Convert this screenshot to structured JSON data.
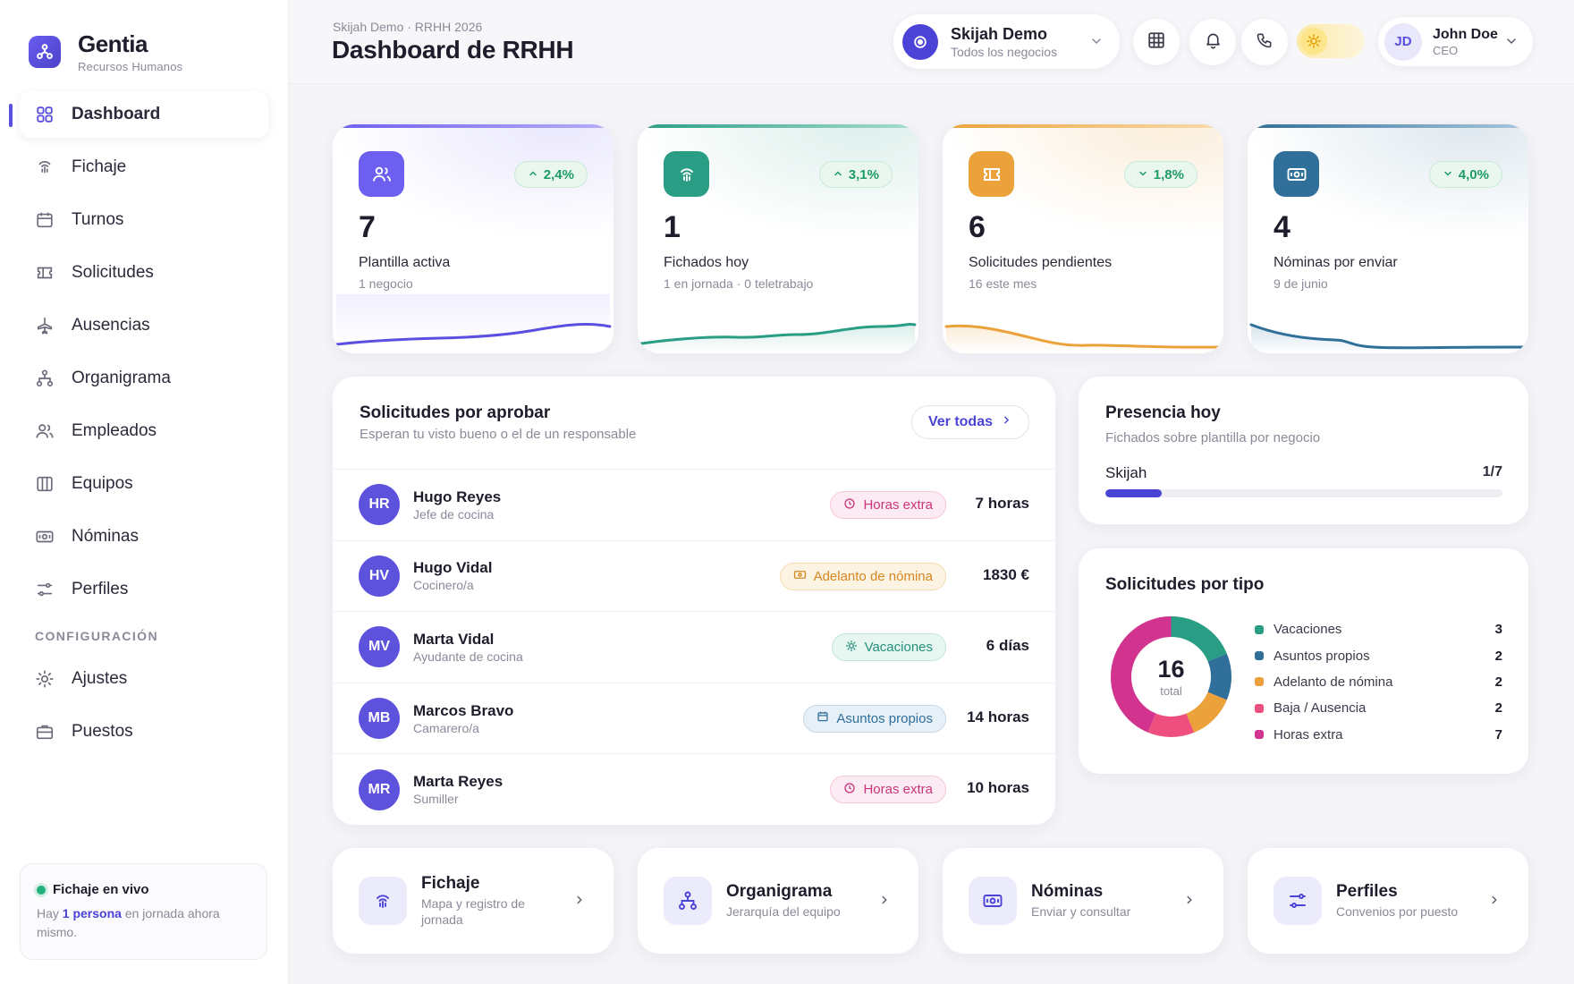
{
  "brand": {
    "name": "Gentia",
    "subtitle": "Recursos Humanos"
  },
  "sidebar": {
    "items": [
      {
        "label": "Dashboard",
        "icon": "grid-icon",
        "active": true
      },
      {
        "label": "Fichaje",
        "icon": "fingerprint-icon"
      },
      {
        "label": "Turnos",
        "icon": "calendar-icon"
      },
      {
        "label": "Solicitudes",
        "icon": "ticket-icon"
      },
      {
        "label": "Ausencias",
        "icon": "plane-icon"
      },
      {
        "label": "Organigrama",
        "icon": "org-chart-icon"
      },
      {
        "label": "Empleados",
        "icon": "users-icon"
      },
      {
        "label": "Equipos",
        "icon": "columns-icon"
      },
      {
        "label": "Nóminas",
        "icon": "banknote-icon"
      },
      {
        "label": "Perfiles",
        "icon": "sliders-icon"
      }
    ],
    "section_label": "CONFIGURACIÓN",
    "config_items": [
      {
        "label": "Ajustes",
        "icon": "sun-gear-icon"
      },
      {
        "label": "Puestos",
        "icon": "briefcase-icon"
      }
    ],
    "live": {
      "title": "Fichaje en vivo",
      "text_before": "Hay ",
      "highlight": "1 persona",
      "text_after": " en jornada ahora mismo."
    }
  },
  "header": {
    "breadcrumb": "Skijah Demo · RRHH 2026",
    "title": "Dashboard de RRHH",
    "org": {
      "name": "Skijah Demo",
      "sub": "Todos los negocios"
    },
    "user": {
      "initials": "JD",
      "name": "John Doe",
      "role": "CEO"
    }
  },
  "kpis": [
    {
      "value": "7",
      "label": "Plantilla activa",
      "sub": "1 negocio",
      "trend": "2,4%",
      "direction": "up",
      "color": "#5a4fe0"
    },
    {
      "value": "1",
      "label": "Fichados hoy",
      "sub": "1 en jornada · 0 teletrabajo",
      "trend": "3,1%",
      "direction": "up",
      "color": "#2a9d85"
    },
    {
      "value": "6",
      "label": "Solicitudes pendientes",
      "sub": "16 este mes",
      "trend": "1,8%",
      "direction": "down",
      "color": "#eba23a"
    },
    {
      "value": "4",
      "label": "Nóminas por enviar",
      "sub": "9 de junio",
      "trend": "4,0%",
      "direction": "down",
      "color": "#2f6f9a"
    }
  ],
  "requests": {
    "title": "Solicitudes por aprobar",
    "subtitle": "Esperan tu visto bueno o el de un responsable",
    "see_all": "Ver todas",
    "rows": [
      {
        "initials": "HR",
        "name": "Hugo Reyes",
        "role": "Jefe de cocina",
        "tag": "Horas extra",
        "amount": "7 horas"
      },
      {
        "initials": "HV",
        "name": "Hugo Vidal",
        "role": "Cocinero/a",
        "tag": "Adelanto de nómina",
        "amount": "1830 €"
      },
      {
        "initials": "MV",
        "name": "Marta Vidal",
        "role": "Ayudante de cocina",
        "tag": "Vacaciones",
        "amount": "6 días"
      },
      {
        "initials": "MB",
        "name": "Marcos Bravo",
        "role": "Camarero/a",
        "tag": "Asuntos propios",
        "amount": "14 horas"
      },
      {
        "initials": "MR",
        "name": "Marta Reyes",
        "role": "Sumiller",
        "tag": "Horas extra",
        "amount": "10 horas"
      }
    ]
  },
  "presence": {
    "title": "Presencia hoy",
    "subtitle": "Fichados sobre plantilla por negocio",
    "business": "Skijah",
    "ratio": "1/7",
    "fraction": 0.142
  },
  "types": {
    "title": "Solicitudes por tipo",
    "total": "16",
    "total_label": "total",
    "items": [
      {
        "label": "Vacaciones",
        "value": "3",
        "color": "#2a9d85"
      },
      {
        "label": "Asuntos propios",
        "value": "2",
        "color": "#2f6f9a"
      },
      {
        "label": "Adelanto de nómina",
        "value": "2",
        "color": "#eba23a"
      },
      {
        "label": "Baja / Ausencia",
        "value": "2",
        "color": "#ef4f7e"
      },
      {
        "label": "Horas extra",
        "value": "7",
        "color": "#d1338f"
      }
    ]
  },
  "shortcuts": [
    {
      "title": "Fichaje",
      "sub": "Mapa y registro de jornada",
      "icon": "fingerprint-icon"
    },
    {
      "title": "Organigrama",
      "sub": "Jerarquía del equipo",
      "icon": "org-chart-icon"
    },
    {
      "title": "Nóminas",
      "sub": "Enviar y consultar",
      "icon": "banknote-icon"
    },
    {
      "title": "Perfiles",
      "sub": "Convenios por puesto",
      "icon": "sliders-icon"
    }
  ]
}
